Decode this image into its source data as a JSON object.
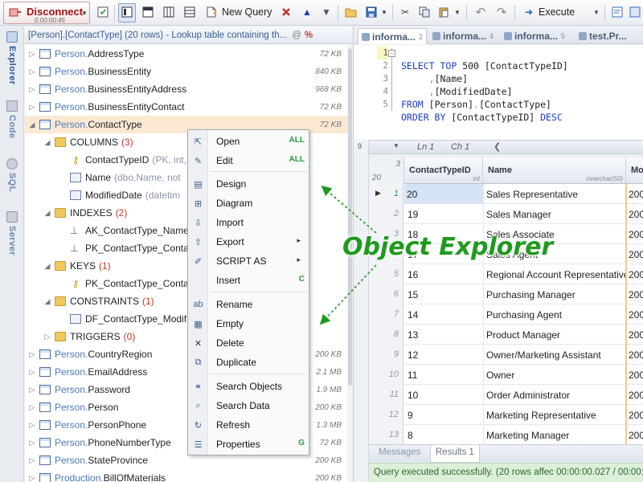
{
  "toolbar": {
    "disconnect_label": "Disconnect",
    "session_time": "0.00:00:45",
    "new_query_label": "New Query",
    "execute_label": "Execute"
  },
  "sidebar": {
    "tabs": [
      {
        "label": "Explorer"
      },
      {
        "label": "Code"
      },
      {
        "label": "SQL"
      },
      {
        "label": "Server"
      }
    ]
  },
  "explorer": {
    "header_title": "[Person].[ContactType] (20 rows) - Lookup table containing th...",
    "header_at": "@",
    "header_pct": "%",
    "rows": [
      {
        "schema": "Person.",
        "name": "AddressType",
        "size": "72 KB",
        "type": "table"
      },
      {
        "schema": "Person.",
        "name": "BusinessEntity",
        "size": "840 KB",
        "type": "table"
      },
      {
        "schema": "Person.",
        "name": "BusinessEntityAddress",
        "size": "968 KB",
        "type": "table"
      },
      {
        "schema": "Person.",
        "name": "BusinessEntityContact",
        "size": "72 KB",
        "type": "table"
      },
      {
        "schema": "Person.",
        "name": "ContactType",
        "size": "72 KB",
        "type": "table"
      },
      {
        "schema": "",
        "name": "COLUMNS",
        "count": "(3)",
        "type": "folder"
      },
      {
        "schema": "",
        "name": "ContactTypeID",
        "meta": "(PK, int,",
        "type": "key"
      },
      {
        "schema": "",
        "name": "Name",
        "meta": "(dbo.Name, not",
        "type": "col"
      },
      {
        "schema": "",
        "name": "ModifiedDate",
        "meta": "(datetim",
        "type": "col"
      },
      {
        "schema": "",
        "name": "INDEXES",
        "count": "(2)",
        "type": "folder"
      },
      {
        "schema": "",
        "name": "AK_ContactType_Name",
        "type": "idx"
      },
      {
        "schema": "",
        "name": "PK_ContactType_Conta",
        "type": "idx"
      },
      {
        "schema": "",
        "name": "KEYS",
        "count": "(1)",
        "type": "folder"
      },
      {
        "schema": "",
        "name": "PK_ContactType_Conta",
        "type": "key"
      },
      {
        "schema": "",
        "name": "CONSTRAINTS",
        "count": "(1)",
        "type": "folder"
      },
      {
        "schema": "",
        "name": "DF_ContactType_Modif",
        "type": "col"
      },
      {
        "schema": "",
        "name": "TRIGGERS",
        "count": "(0)",
        "type": "folder"
      },
      {
        "schema": "Person.",
        "name": "CountryRegion",
        "size": "200 KB",
        "type": "table"
      },
      {
        "schema": "Person.",
        "name": "EmailAddress",
        "size": "2.1 MB",
        "type": "table"
      },
      {
        "schema": "Person.",
        "name": "Password",
        "size": "1.9 MB",
        "type": "table"
      },
      {
        "schema": "Person.",
        "name": "Person",
        "size": "200 KB",
        "type": "table"
      },
      {
        "schema": "Person.",
        "name": "PersonPhone",
        "size": "1.3 MB",
        "type": "table"
      },
      {
        "schema": "Person.",
        "name": "PhoneNumberType",
        "size": "72 KB",
        "type": "table"
      },
      {
        "schema": "Person.",
        "name": "StateProvince",
        "size": "200 KB",
        "type": "table"
      },
      {
        "schema": "Production.",
        "name": "BillOfMaterials",
        "size": "200 KB",
        "type": "table"
      }
    ]
  },
  "context_menu": {
    "items": [
      {
        "label": "Open",
        "shortcut": "ALL",
        "icon": "open-icon"
      },
      {
        "label": "Edit",
        "shortcut": "ALL",
        "icon": "edit-icon"
      },
      {
        "label": "Design",
        "icon": "design-icon"
      },
      {
        "label": "Diagram",
        "icon": "diagram-icon"
      },
      {
        "label": "Import",
        "icon": "import-icon"
      },
      {
        "label": "Export",
        "submenu": "▸",
        "icon": "export-icon"
      },
      {
        "label": "SCRIPT AS",
        "submenu": "▸",
        "icon": "script-icon"
      },
      {
        "label": "Insert",
        "shortcut": "C",
        "icon": "insert-icon"
      },
      {
        "label": "Rename",
        "icon": "rename-icon"
      },
      {
        "label": "Empty",
        "icon": "empty-icon"
      },
      {
        "label": "Delete",
        "icon": "delete-icon"
      },
      {
        "label": "Duplicate",
        "icon": "duplicate-icon"
      },
      {
        "label": "Search Objects",
        "icon": "binoculars-icon"
      },
      {
        "label": "Search Data",
        "icon": "search-data-icon"
      },
      {
        "label": "Refresh",
        "icon": "refresh-icon"
      },
      {
        "label": "Properties",
        "shortcut": "G",
        "icon": "properties-icon"
      }
    ]
  },
  "editor_tabs": [
    {
      "label": "informa...",
      "num": "2"
    },
    {
      "label": "informa...",
      "num": "4"
    },
    {
      "label": "informa...",
      "num": "5"
    },
    {
      "label": "test.Pr...",
      "num": ""
    }
  ],
  "code": {
    "line_numbers": [
      "1",
      "2",
      "3",
      "4",
      "5"
    ],
    "l1": {
      "kw1": "SELECT",
      "kw2": "TOP",
      "num": "500",
      "rest": "[ContactTypeID]"
    },
    "l2": {
      "pun": ",",
      "rest": "[Name]"
    },
    "l3": {
      "pun": ",",
      "rest": "[ModifiedDate]"
    },
    "l4": {
      "kw": "FROM",
      "rest1": "[Person]",
      "dot": ".",
      "rest2": "[ContactType]"
    },
    "l5": {
      "kw1": "ORDER BY",
      "rest": "[ContactTypeID]",
      "kw2": "DESC"
    }
  },
  "code_status": {
    "zoom": "9",
    "line": "Ln 1",
    "col": "Ch 1"
  },
  "grid": {
    "corner_top": "3",
    "corner_bottom": "20",
    "columns": [
      {
        "name": "ContactTypeID",
        "type": "int"
      },
      {
        "name": "Name",
        "type": "nvarchar(50)"
      },
      {
        "name": "Mo",
        "type": ""
      }
    ],
    "rows": [
      {
        "rn": "1",
        "id": "20",
        "name": "Sales Representative",
        "mod": "200"
      },
      {
        "rn": "2",
        "id": "19",
        "name": "Sales Manager",
        "mod": "200"
      },
      {
        "rn": "3",
        "id": "18",
        "name": "Sales Associate",
        "mod": "200"
      },
      {
        "rn": "4",
        "id": "17",
        "name": "Sales Agent",
        "mod": "200"
      },
      {
        "rn": "5",
        "id": "16",
        "name": "Regional Account Representative",
        "mod": "200"
      },
      {
        "rn": "6",
        "id": "15",
        "name": "Purchasing Manager",
        "mod": "200"
      },
      {
        "rn": "7",
        "id": "14",
        "name": "Purchasing Agent",
        "mod": "200"
      },
      {
        "rn": "8",
        "id": "13",
        "name": "Product Manager",
        "mod": "200"
      },
      {
        "rn": "9",
        "id": "12",
        "name": "Owner/Marketing Assistant",
        "mod": "200"
      },
      {
        "rn": "10",
        "id": "11",
        "name": "Owner",
        "mod": "200"
      },
      {
        "rn": "11",
        "id": "10",
        "name": "Order Administrator",
        "mod": "200"
      },
      {
        "rn": "12",
        "id": "9",
        "name": "Marketing Representative",
        "mod": "200"
      },
      {
        "rn": "13",
        "id": "8",
        "name": "Marketing Manager",
        "mod": "200"
      }
    ]
  },
  "result_tabs": [
    {
      "label": "Messages"
    },
    {
      "label": "Results 1"
    }
  ],
  "status_text": "Query executed successfully. (20 rows affec 00:00:00.027 / 00:00:00.",
  "callout_text": "Object Explorer",
  "colors": {
    "accent": "#2a5599",
    "callout": "#1f9a1f",
    "selection": "#fbe9d4",
    "status_bg": "#dcefd9"
  }
}
